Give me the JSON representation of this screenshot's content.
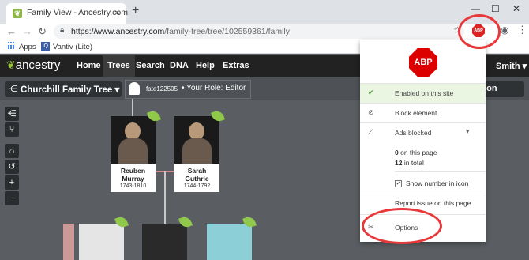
{
  "browser": {
    "tab_title": "Family View - Ancestry.com",
    "url_main": "https://www.ancestry.com",
    "url_rest": "/family-tree/tree/102559361/family",
    "bookmarks": [
      {
        "label": "Apps"
      },
      {
        "label": "Vantiv (Lite)"
      }
    ],
    "extension_label": "ABP"
  },
  "ancestry": {
    "logo_text": "ancestry",
    "nav": [
      "Home",
      "Trees",
      "Search",
      "DNA",
      "Help",
      "Extras"
    ],
    "active_nav": "Trees",
    "user_partial": "Smith",
    "tree_name": "Churchill Family Tree",
    "username": "fate122505",
    "role": "Your Role: Editor",
    "right_pill_partial": "son"
  },
  "people": [
    {
      "first": "Reuben",
      "last": "Murray",
      "years": "1743-1810"
    },
    {
      "first": "Sarah",
      "last": "Guthrie",
      "years": "1744-1792"
    }
  ],
  "abp_popup": {
    "logo_text": "ABP",
    "enabled_label": "Enabled on this site",
    "block_label": "Block element",
    "ads_blocked_label": "Ads blocked",
    "on_page_count": "0",
    "on_page_label": "on this page",
    "total_count": "12",
    "total_label": "in total",
    "show_number_label": "Show number in icon",
    "report_label": "Report issue on this page",
    "options_label": "Options"
  },
  "colors": {
    "highlight": "#e8393a",
    "abp_red": "#d00",
    "ancestry_green": "#9bc53d"
  }
}
